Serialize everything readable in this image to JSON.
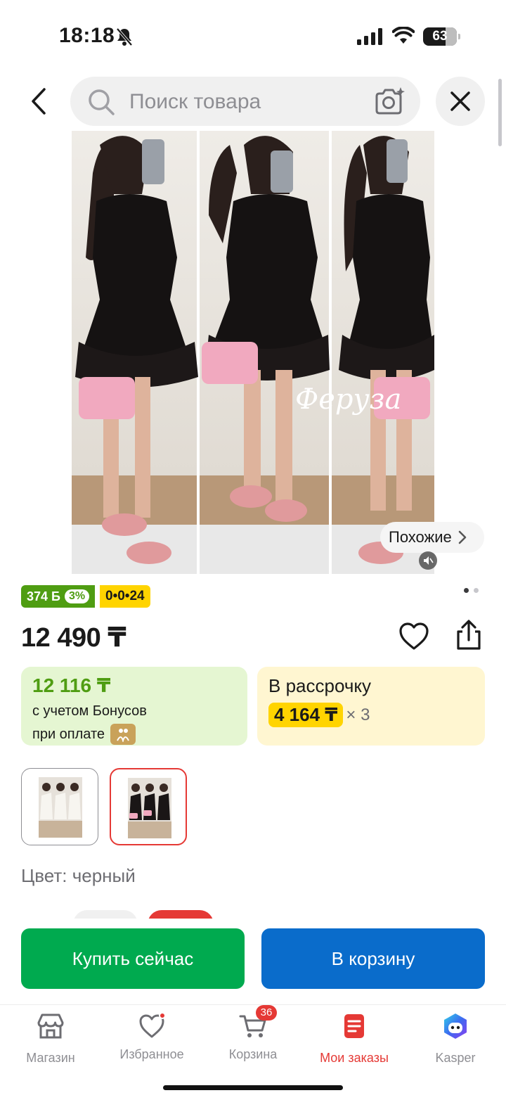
{
  "status_bar": {
    "time": "18:18",
    "battery": "63"
  },
  "search": {
    "placeholder": "Поиск товара"
  },
  "product": {
    "image_watermark": "Феруза",
    "similar_label": "Похожие",
    "bonus_badge": {
      "points": "374 Б",
      "percent": "3%"
    },
    "installment_badge": "0•0•24",
    "price": "12 490 ₸",
    "bonus_card": {
      "price": "12 116 ₸",
      "line1": "с учетом Бонусов",
      "line2": "при оплате"
    },
    "installment_card": {
      "title": "В рассрочку",
      "amount": "4 164 ₸",
      "times": "× 3"
    },
    "color_label": "Цвет: черный",
    "variants": [
      "white",
      "black"
    ],
    "selected_variant": "black"
  },
  "actions": {
    "buy_now": "Купить сейчас",
    "add_to_cart": "В корзину"
  },
  "tab_bar": {
    "items": [
      {
        "label": "Магазин",
        "icon": "store-icon"
      },
      {
        "label": "Избранное",
        "icon": "heart-icon"
      },
      {
        "label": "Корзина",
        "icon": "cart-icon",
        "badge": "36"
      },
      {
        "label": "Мои заказы",
        "icon": "orders-icon",
        "active": true
      },
      {
        "label": "Kasper",
        "icon": "kasper-icon"
      }
    ]
  },
  "colors": {
    "accent_red": "#e53935",
    "buy_green": "#00aa4f",
    "cart_blue": "#0a6ccb",
    "bonus_green": "#4f9d12",
    "installment_yellow": "#ffd400"
  }
}
